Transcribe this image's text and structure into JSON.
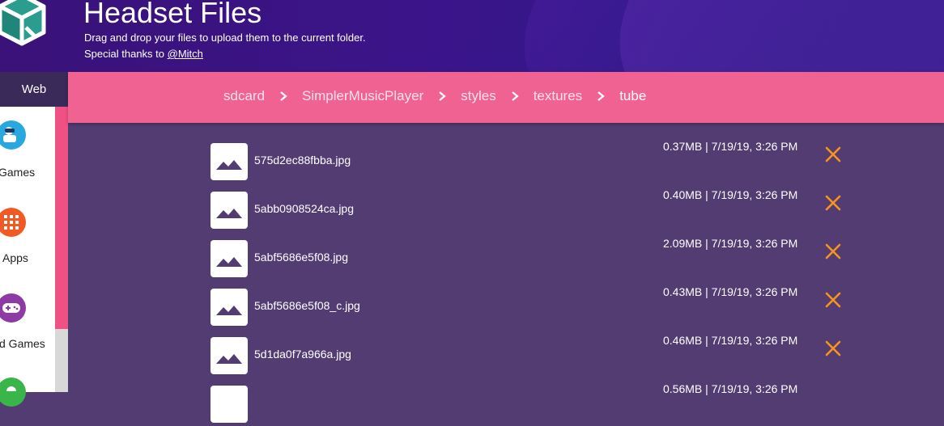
{
  "header": {
    "title": "Headset Files",
    "subtitle_line1": "Drag and drop your files to upload them to the current folder.",
    "subtitle_line2_prefix": "Special thanks to ",
    "subtitle_link": "@Mitch"
  },
  "sidebar": {
    "web_tab": "Web",
    "items": [
      {
        "label": "Games",
        "icon": "vr-headset-icon",
        "color": "#29a8e0"
      },
      {
        "label": "Apps",
        "icon": "apps-grid-icon",
        "color": "#f15a24"
      },
      {
        "label": "d Games",
        "icon": "gamepad-icon",
        "color": "#8e3aa5"
      },
      {
        "label": "",
        "icon": "android-icon",
        "color": "#3ab54a"
      }
    ]
  },
  "breadcrumb": [
    "sdcard",
    "SimplerMusicPlayer",
    "styles",
    "textures",
    "tube"
  ],
  "files": [
    {
      "name": "575d2ec88fbba.jpg",
      "meta": "0.37MB | 7/19/19, 3:26 PM"
    },
    {
      "name": "5abb0908524ca.jpg",
      "meta": "0.40MB | 7/19/19, 3:26 PM"
    },
    {
      "name": "5abf5686e5f08.jpg",
      "meta": "2.09MB | 7/19/19, 3:26 PM"
    },
    {
      "name": "5abf5686e5f08_c.jpg",
      "meta": "0.43MB | 7/19/19, 3:26 PM"
    },
    {
      "name": "5d1da0f7a966a.jpg",
      "meta": "0.46MB | 7/19/19, 3:26 PM"
    },
    {
      "name": "",
      "meta": "0.56MB | 7/19/19, 3:26 PM"
    }
  ],
  "colors": {
    "accent_pink": "#f06292",
    "delete_orange": "#f7941d",
    "list_bg": "#533c72"
  }
}
